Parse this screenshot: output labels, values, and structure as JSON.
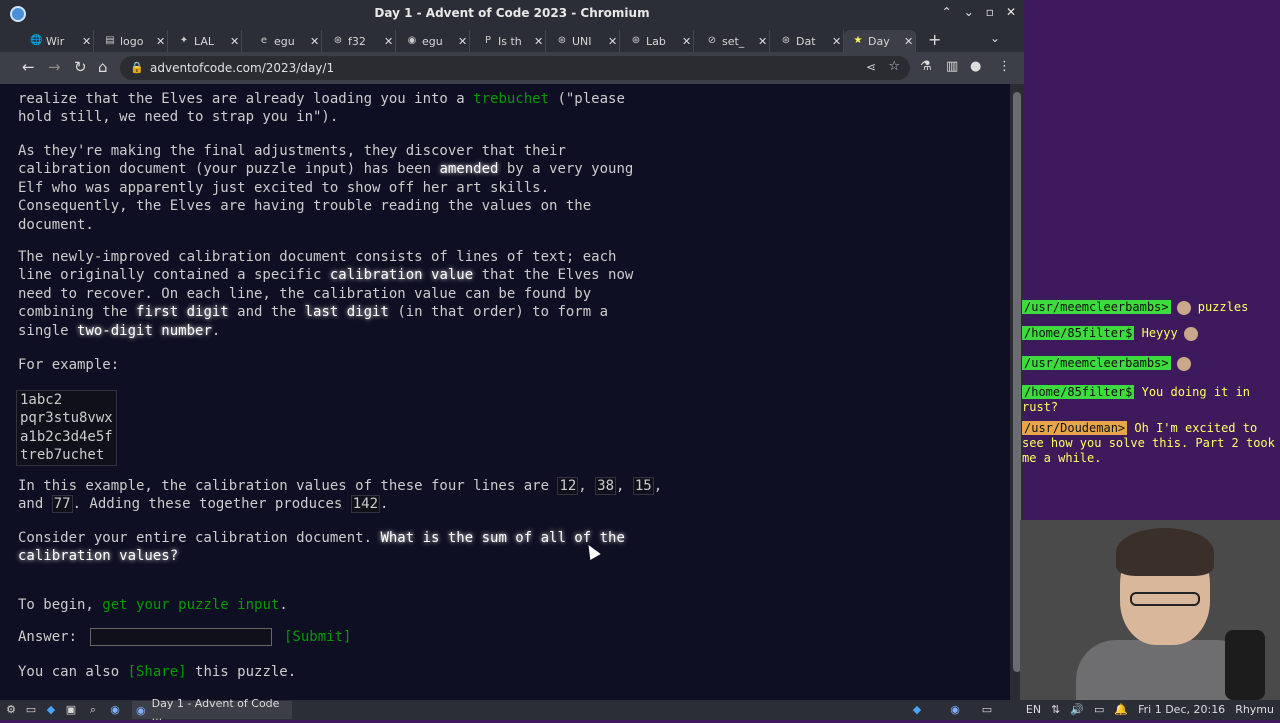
{
  "window": {
    "title": "Day 1 - Advent of Code 2023 - Chromium",
    "controls": [
      "⌃",
      "⌄",
      "▫",
      "✕"
    ]
  },
  "tabs": [
    {
      "icon": "🌐",
      "label": "Wir"
    },
    {
      "icon": "▤",
      "label": "logo"
    },
    {
      "icon": "✦",
      "label": "LAL"
    },
    {
      "icon": "e",
      "label": "egu"
    },
    {
      "icon": "⊛",
      "label": "f32"
    },
    {
      "icon": "◉",
      "label": "egu"
    },
    {
      "icon": "P",
      "label": "Is th"
    },
    {
      "icon": "⊛",
      "label": "UNI"
    },
    {
      "icon": "⊛",
      "label": "Lab"
    },
    {
      "icon": "⊘",
      "label": "set_"
    },
    {
      "icon": "⊛",
      "label": "Dat"
    },
    {
      "icon": "★",
      "label": "Day"
    }
  ],
  "nav": {
    "back": "←",
    "forward": "→",
    "reload": "↻",
    "home": "⌂"
  },
  "url": "adventofcode.com/2023/day/1",
  "content": {
    "p1a": "realize that the Elves are already loading you into a ",
    "p1link": "trebuchet",
    "p1b": " (\"please",
    "p1c": "hold still, we need to strap you in\").",
    "p2a": "As they're making the final adjustments, they discover that their",
    "p2b": "calibration document (your puzzle input) has been ",
    "p2amended": "amended",
    "p2c": " by a very young",
    "p2d": "Elf who was apparently just excited to show off her art skills.",
    "p2e": "Consequently, the Elves are having trouble reading the values on the",
    "p2f": "document.",
    "p3a": "The newly-improved calibration document consists of lines of text; each",
    "p3b": "line originally contained a specific ",
    "p3cv": "calibration value",
    "p3c": " that the Elves now",
    "p3d": "need to recover. On each line, the calibration value can be found by",
    "p3e": "combining the ",
    "p3first": "first digit",
    "p3f": " and the ",
    "p3last": "last digit",
    "p3g": " (in that order) to form a",
    "p3h": "single ",
    "p3two": "two-digit number",
    "p3i": ".",
    "p4": "For example:",
    "example": [
      "1abc2",
      "pqr3stu8vwx",
      "a1b2c3d4e5f",
      "treb7uchet"
    ],
    "p5a": "In this example, the calibration values of these four lines are ",
    "v1": "12",
    "v2": "38",
    "v3": "15",
    "v4": "77",
    "sum": "142",
    "p5and": "and ",
    "p5b": ". Adding these together produces ",
    "p6a": "Consider your entire calibration document. ",
    "p6q1": "What is the sum of all of the",
    "p6q2": "calibration values?",
    "p7a": "To begin, ",
    "p7link": "get your puzzle input",
    "p7b": ".",
    "answer_label": "Answer:",
    "submit": "[Submit]",
    "share_a": "You can also ",
    "share_link": "[Share]",
    "share_b": " this puzzle."
  },
  "chat": [
    {
      "user": "/usr/meemcleerbambs>",
      "text": "puzzles"
    },
    {
      "user": "/home/85filter$",
      "text": "Heyyy"
    },
    {
      "user": "/usr/meemcleerbambs>",
      "text": ""
    },
    {
      "user": "/home/85filter$",
      "text": "You doing it in rust?"
    },
    {
      "user": "/usr/Doudeman>",
      "text": "Oh I'm excited to see how you solve this. Part 2 took me a while."
    }
  ],
  "taskbar": {
    "window_title": "Day 1 - Advent of Code ...",
    "lang": "EN",
    "clock": "Fri 1 Dec, 20:16",
    "user": "Rhymu"
  }
}
